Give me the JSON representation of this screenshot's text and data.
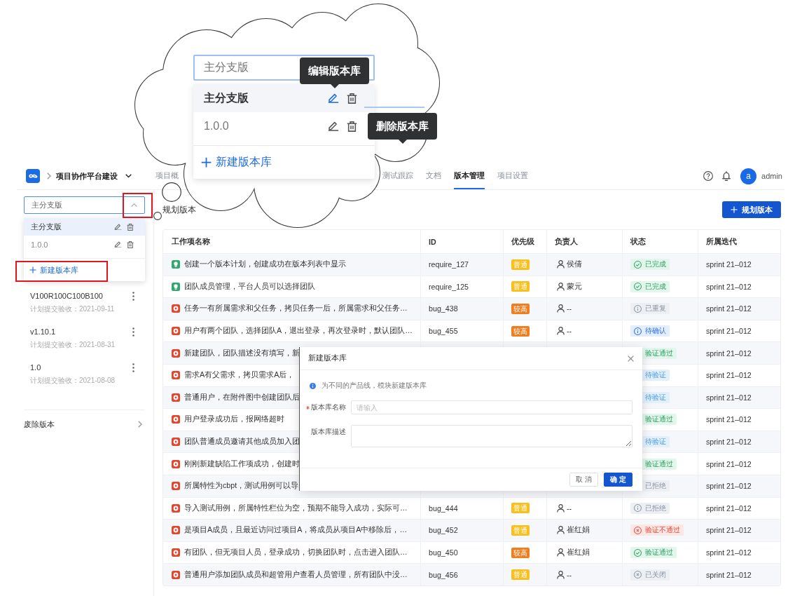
{
  "callout": {
    "select": {
      "value": "主分支版"
    },
    "options": [
      {
        "label": "主分支版",
        "selected": true
      },
      {
        "label": "1.0.0",
        "selected": false
      }
    ],
    "create_label": "新建版本库",
    "tooltips": [
      {
        "text": "编辑版本库"
      },
      {
        "text": "删除版本库"
      }
    ]
  },
  "header": {
    "project": "项目协作平台建设",
    "tabs": [
      {
        "label": "项目概",
        "selected": false
      },
      {
        "label": "测试跟踪",
        "selected": false
      },
      {
        "label": "文档",
        "selected": false
      },
      {
        "label": "版本管理",
        "selected": true
      },
      {
        "label": "项目设置",
        "selected": false
      }
    ],
    "user": {
      "initial": "a",
      "name": "admin"
    }
  },
  "sidebar": {
    "select": {
      "value": "主分支版",
      "expanded": true
    },
    "options": [
      {
        "label": "主分支版",
        "selected": true
      },
      {
        "label": "1.0.0",
        "selected": false
      }
    ],
    "create_label": "新建版本库",
    "versions": [
      {
        "name": "V100R100C100B100",
        "date": "计划提交验收：2021-09-11"
      },
      {
        "name": "v1.10.1",
        "date": "计划提交验收：2021-08-31"
      },
      {
        "name": "1.0",
        "date": "计划提交验收：2021-08-08"
      }
    ],
    "footer": "废除版本"
  },
  "page": {
    "title": "规划版本",
    "button": "规划版本"
  },
  "table": {
    "columns": [
      "工作项名称",
      "ID",
      "优先级",
      "负责人",
      "状态",
      "所属迭代"
    ],
    "rows": [
      {
        "kind": "requirement",
        "title": "创建一个版本计划，创建成功在版本列表中显示",
        "id": "require_127",
        "priority": {
          "label": "普通",
          "kind": "normal"
        },
        "owner": "侯倩",
        "status": {
          "label": "已完成",
          "kind": "done"
        },
        "iteration": "sprint 21–012"
      },
      {
        "kind": "requirement",
        "title": "团队成员管理，平台人员可以选择团队",
        "id": "require_125",
        "priority": {
          "label": "普通",
          "kind": "normal"
        },
        "owner": "蒙元",
        "status": {
          "label": "已完成",
          "kind": "done"
        },
        "iteration": "sprint 21–012"
      },
      {
        "kind": "bug",
        "title": "任务一有所属需求和父任务，拷贝任务一后，所属需求和父任务…",
        "id": "bug_438",
        "priority": {
          "label": "较高",
          "kind": "high"
        },
        "owner": "--",
        "status": {
          "label": "已重复",
          "kind": "duplicate"
        },
        "iteration": "sprint 21–012"
      },
      {
        "kind": "bug",
        "title": "用户有两个团队，选择团队A，退出登录，再次登录时，默认团队…",
        "id": "bug_455",
        "priority": {
          "label": "较高",
          "kind": "high"
        },
        "owner": "--",
        "status": {
          "label": "待确认",
          "kind": "confirm"
        },
        "iteration": "sprint 21–012"
      },
      {
        "kind": "bug",
        "title": "新建团队，团队描述没有填写，新",
        "status": {
          "label": "验证通过",
          "kind": "pass"
        },
        "iteration": "sprint 21–012"
      },
      {
        "kind": "bug",
        "title": "需求A有父需求，拷贝需求A后，",
        "status": {
          "label": "待验证",
          "kind": "verify"
        },
        "iteration": "sprint 21–012"
      },
      {
        "kind": "bug",
        "title": "普通用户，在附件图中创建团队后",
        "status": {
          "label": "待验证",
          "kind": "verify"
        },
        "iteration": "sprint 21–012"
      },
      {
        "kind": "bug",
        "title": "用户登录成功后，报网络超时",
        "status": {
          "label": "验证通过",
          "kind": "pass"
        },
        "iteration": "sprint 21–012"
      },
      {
        "kind": "bug",
        "title": "团队普通成员邀请其他成员加入团",
        "status": {
          "label": "待验证",
          "kind": "verify"
        },
        "iteration": "sprint 21–012"
      },
      {
        "kind": "bug",
        "title": "刚刚新建缺陷工作项成功，创建时",
        "status": {
          "label": "验证通过",
          "kind": "pass"
        },
        "iteration": "sprint 21–012"
      },
      {
        "kind": "bug",
        "title": "所属特性为cbpt，测试用例可以导",
        "status": {
          "label": "已拒绝",
          "kind": "rejected"
        },
        "iteration": "sprint 21–012"
      },
      {
        "kind": "bug",
        "title": "导入测试用例，所属特性栏位为空，预期不能导入成功，实际可…",
        "id": "bug_444",
        "priority": {
          "label": "普通",
          "kind": "normal"
        },
        "owner": "--",
        "status": {
          "label": "已拒绝",
          "kind": "rejected"
        },
        "iteration": "sprint 21–012"
      },
      {
        "kind": "bug",
        "title": "是项目A成员，且最近访问过项目A，将成员从项目A中移除后，…",
        "id": "bug_452",
        "priority": {
          "label": "普通",
          "kind": "normal"
        },
        "owner": "崔红娟",
        "status": {
          "label": "验证不通过",
          "kind": "fail"
        },
        "iteration": "sprint 21–012"
      },
      {
        "kind": "bug",
        "title": "有团队，但无项目人员，登录成功，切换团队时，点击进入团队…",
        "id": "bug_450",
        "priority": {
          "label": "较高",
          "kind": "high"
        },
        "owner": "崔红娟",
        "status": {
          "label": "验证通过",
          "kind": "pass"
        },
        "iteration": "sprint 21–012"
      },
      {
        "kind": "bug",
        "title": "普通用户添加团队成员和超管用户查看人员管理，所有团队中没…",
        "id": "bug_456",
        "priority": {
          "label": "普通",
          "kind": "normal"
        },
        "owner": "--",
        "status": {
          "label": "已关闭",
          "kind": "closed"
        },
        "iteration": "sprint 21–012"
      }
    ]
  },
  "dialog": {
    "title": "新建版本库",
    "info": "为不同的产品线，模块新建版本库",
    "fields": [
      {
        "label": "版本库名称",
        "required": true,
        "kind": "input",
        "placeholder": "请输入"
      },
      {
        "label": "版本库描述",
        "required": false,
        "kind": "textarea"
      }
    ],
    "buttons": [
      {
        "label": "取 消",
        "primary": false
      },
      {
        "label": "确 定",
        "primary": true
      }
    ]
  }
}
